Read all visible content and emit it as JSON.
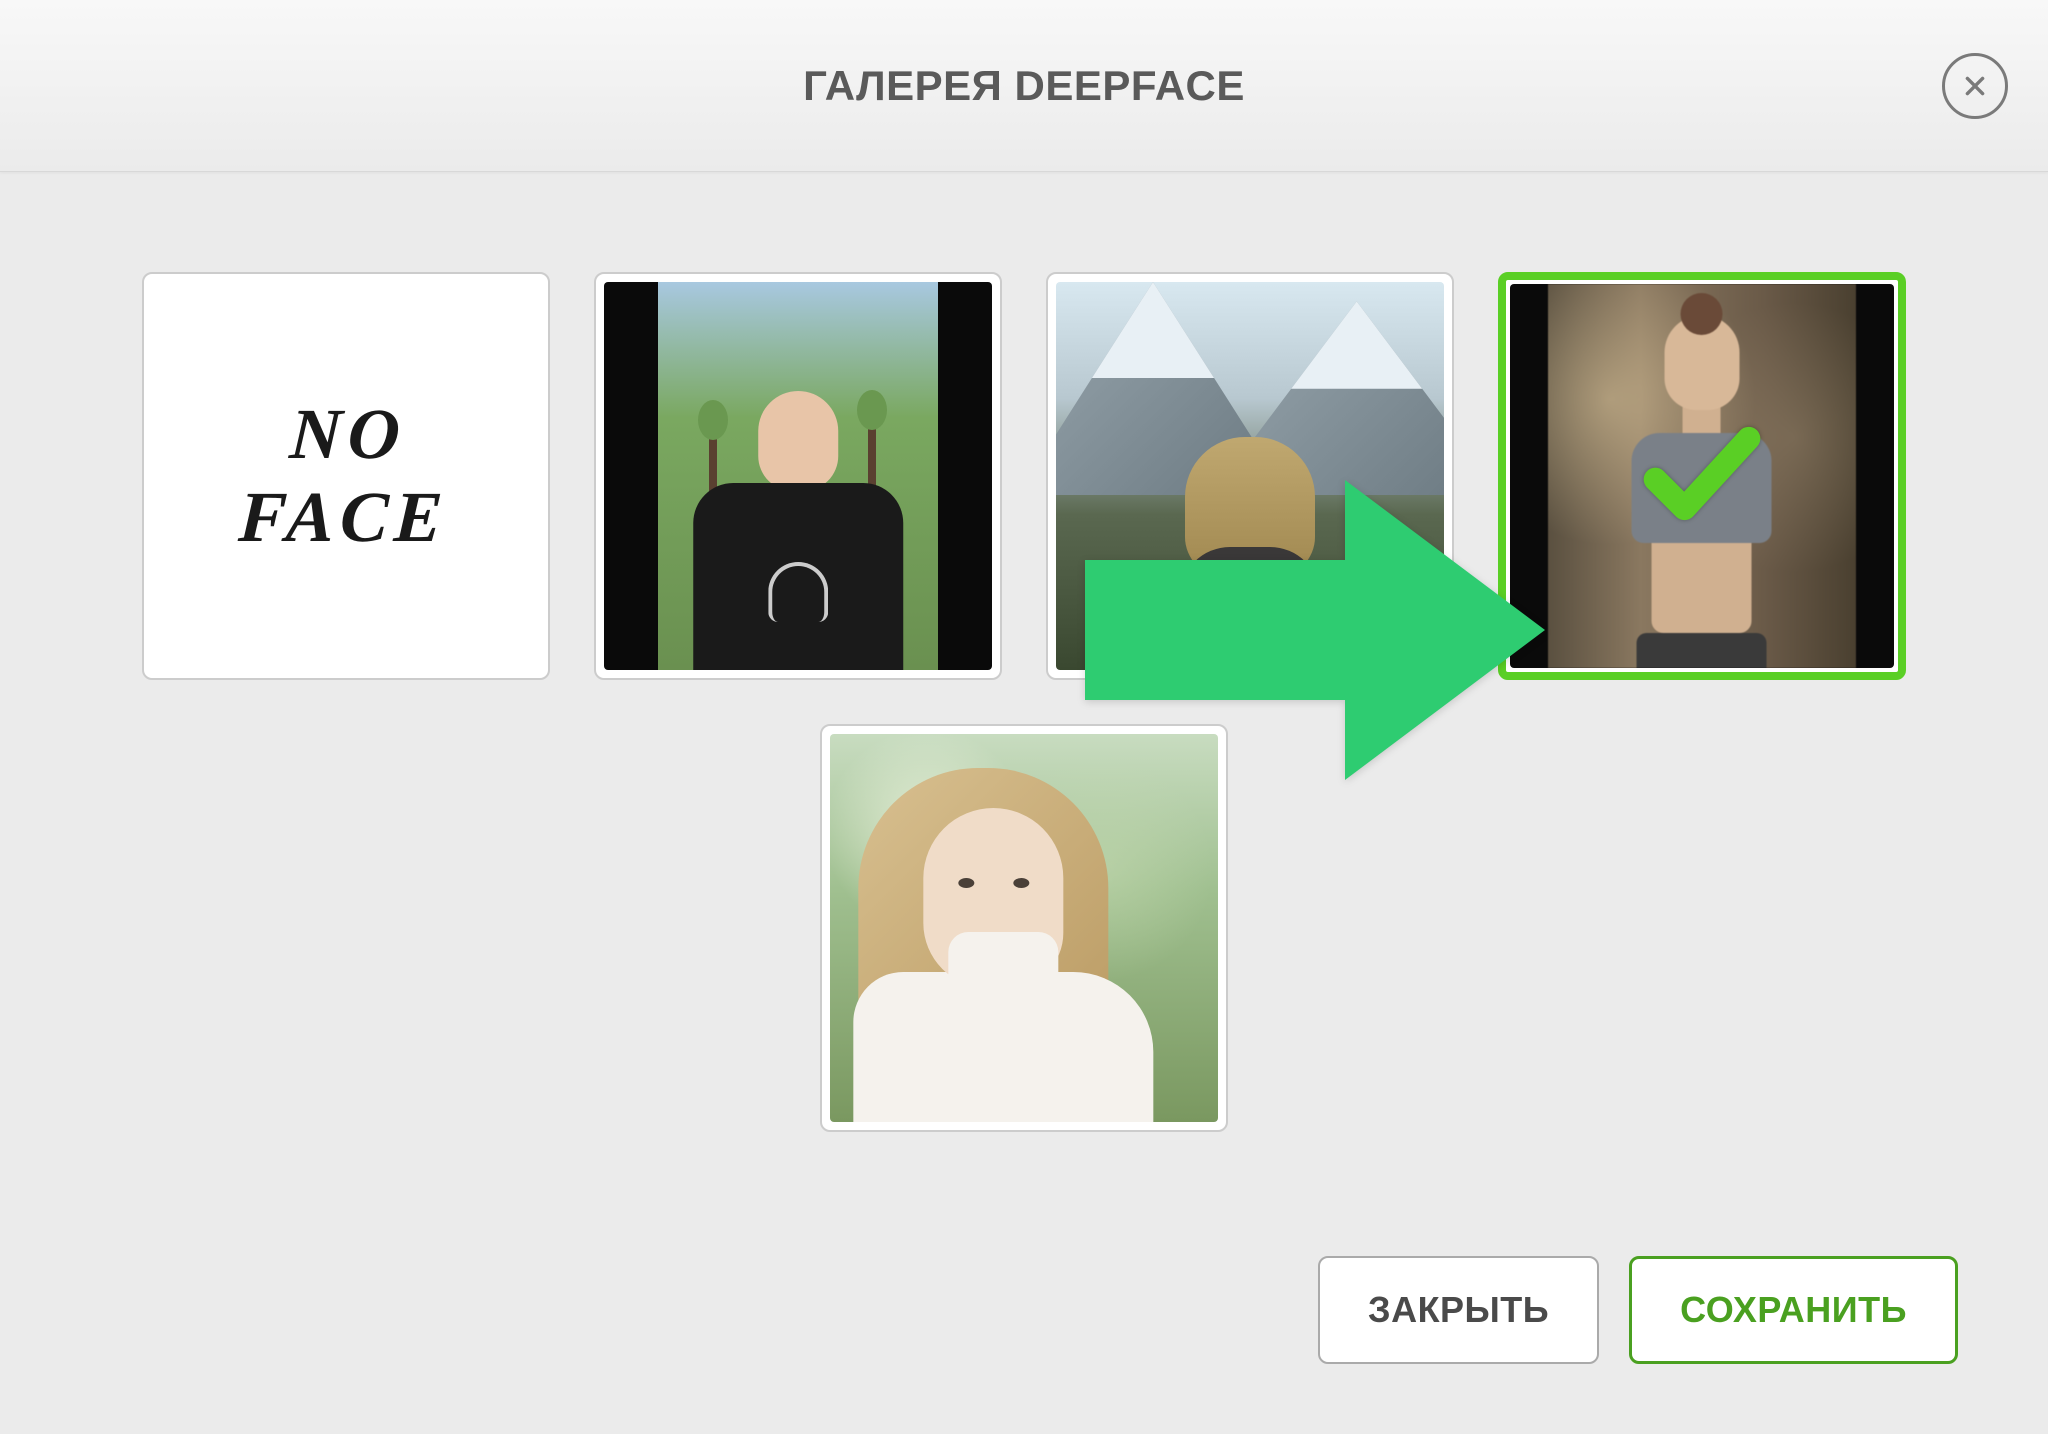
{
  "header": {
    "title": "ГАЛЕРЕЯ DEEPFACE"
  },
  "gallery": {
    "items": [
      {
        "id": "no-face",
        "selected": false,
        "label_l1": "NO",
        "label_l2": "FACE"
      },
      {
        "id": "man-park",
        "selected": false
      },
      {
        "id": "woman-mountains",
        "selected": false
      },
      {
        "id": "woman-gym",
        "selected": true
      },
      {
        "id": "woman-blonde-park",
        "selected": false
      }
    ]
  },
  "footer": {
    "close_label": "ЗАКРЫТЬ",
    "save_label": "СОХРАНИТЬ"
  },
  "colors": {
    "accent": "#5acf25",
    "arrow": "#2ecc71"
  }
}
